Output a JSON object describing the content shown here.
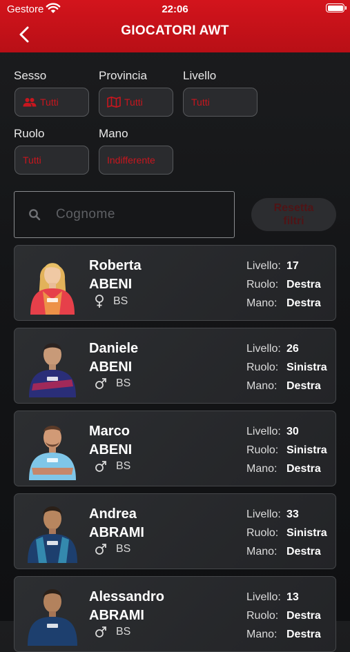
{
  "status": {
    "carrier": "Gestore",
    "time": "22:06"
  },
  "header": {
    "title": "GIOCATORI AWT"
  },
  "filters": [
    {
      "label": "Sesso",
      "value": "Tutti",
      "icon": "people-icon"
    },
    {
      "label": "Provincia",
      "value": "Tutti",
      "icon": "map-icon"
    },
    {
      "label": "Livello",
      "value": "Tutti",
      "icon": ""
    },
    {
      "label": "Ruolo",
      "value": "Tutti",
      "icon": ""
    },
    {
      "label": "Mano",
      "value": "Indifferente",
      "icon": ""
    }
  ],
  "search": {
    "placeholder": "Cognome",
    "value": ""
  },
  "reset_label_line1": "Resetta",
  "reset_label_line2": "filtri",
  "stat_labels": {
    "livello": "Livello:",
    "ruolo": "Ruolo:",
    "mano": "Mano:"
  },
  "players": [
    {
      "first": "Roberta",
      "last": "ABENI",
      "gender": "female",
      "province": "BS",
      "livello": "17",
      "ruolo": "Destra",
      "mano": "Destra"
    },
    {
      "first": "Daniele",
      "last": "ABENI",
      "gender": "male",
      "province": "BS",
      "livello": "26",
      "ruolo": "Sinistra",
      "mano": "Destra"
    },
    {
      "first": "Marco",
      "last": "ABENI",
      "gender": "male",
      "province": "BS",
      "livello": "30",
      "ruolo": "Sinistra",
      "mano": "Destra"
    },
    {
      "first": "Andrea",
      "last": "ABRAMI",
      "gender": "male",
      "province": "BS",
      "livello": "33",
      "ruolo": "Sinistra",
      "mano": "Destra"
    },
    {
      "first": "Alessandro",
      "last": "ABRAMI",
      "gender": "male",
      "province": "BS",
      "livello": "13",
      "ruolo": "Destra",
      "mano": "Destra"
    }
  ],
  "colors": {
    "brand_red": "#c8161e",
    "header_red": "#c4121a",
    "background": "#141517"
  }
}
